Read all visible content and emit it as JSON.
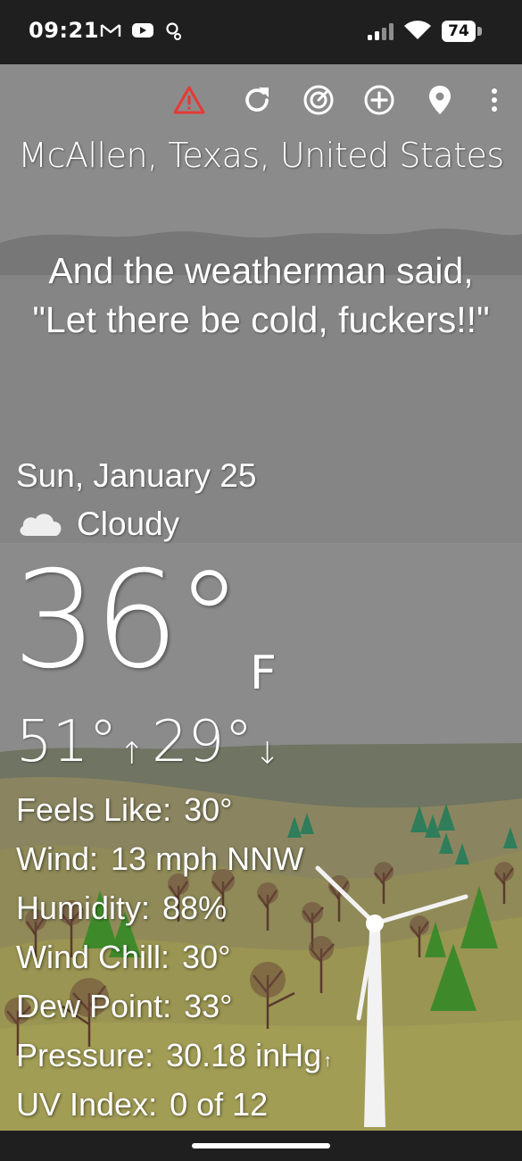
{
  "status_bar": {
    "time": "09:21",
    "battery": "74",
    "icons": [
      "gmail-icon",
      "youtube-icon",
      "search-notification-icon",
      "signal-icon",
      "wifi-icon",
      "battery-icon"
    ]
  },
  "toolbar": {
    "icons": [
      "alert-icon",
      "refresh-icon",
      "radar-icon",
      "add-location-icon",
      "location-pin-icon",
      "more-vert-icon"
    ],
    "alert_color": "#e53935"
  },
  "location": "McAllen, Texas, United States",
  "quote": "And the weatherman said, \"Let there be cold, fuckers!!\"",
  "date": "Sun, January 25",
  "condition": {
    "icon": "cloud-icon",
    "label": "Cloudy"
  },
  "temperature": {
    "current": "36°",
    "unit": "F",
    "high": "51°",
    "low": "29°",
    "high_arrow": "↑",
    "low_arrow": "↓"
  },
  "details": [
    {
      "label": "Feels Like:",
      "value": "30°"
    },
    {
      "label": "Wind:",
      "value": "13 mph NNW"
    },
    {
      "label": "Humidity:",
      "value": "88%"
    },
    {
      "label": "Wind Chill:",
      "value": "30°"
    },
    {
      "label": "Dew Point:",
      "value": "33°"
    },
    {
      "label": "Pressure:",
      "value": "30.18 inHg"
    },
    {
      "label": "UV Index:",
      "value": "0 of 12"
    }
  ],
  "pressure_trend": "↑"
}
